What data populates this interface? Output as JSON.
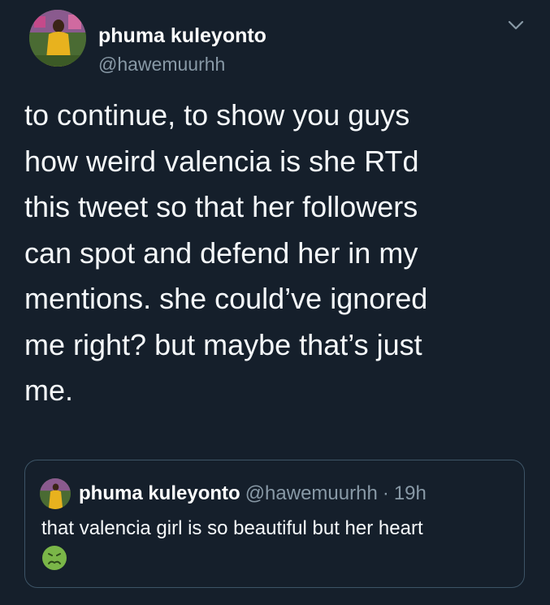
{
  "tweet": {
    "author_name": "phuma kuleyonto",
    "author_handle": "@hawemuurhh",
    "text": "to continue, to show you guys\nhow weird valencia is she RTd\nthis tweet so that her followers\ncan spot and defend her in my\nmentions. she could’ve ignored\nme right? but maybe that’s just\nme.",
    "menu_icon": "chevron-down-icon",
    "avatar_icon": "profile-photo"
  },
  "quoted_tweet": {
    "author_name": "phuma kuleyonto",
    "author_handle": "@hawemuurhh",
    "separator": "·",
    "time": "19h",
    "text": "that valencia girl is so beautiful but her heart",
    "emoji_icon": "nauseated-face-emoji"
  },
  "colors": {
    "background": "#151f2b",
    "text_primary": "#ffffff",
    "text_secondary": "#8899a6",
    "border": "#3d5466",
    "emoji_green": "#7ab648"
  }
}
